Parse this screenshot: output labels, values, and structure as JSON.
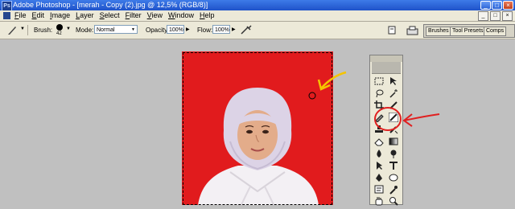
{
  "window": {
    "title": "Adobe Photoshop - [merah - Copy (2).jpg @ 12,5% (RGB/8)]",
    "icon": "photoshop-icon",
    "minimize": "_",
    "maximize": "□",
    "close": "×"
  },
  "menu": {
    "items": [
      "File",
      "Edit",
      "Image",
      "Layer",
      "Select",
      "Filter",
      "View",
      "Window",
      "Help"
    ]
  },
  "options": {
    "brush_label": "Brush:",
    "brush_size": "42",
    "mode_label": "Mode:",
    "mode_value": "Normal",
    "opacity_label": "Opacity:",
    "opacity_value": "100%",
    "flow_label": "Flow:",
    "flow_value": "100%",
    "dropdown_arrow": "▼",
    "flow_arrow": "▶"
  },
  "palette_well": {
    "tabs": [
      "Brushes",
      "Tool Presets",
      "Comps"
    ]
  },
  "colors": {
    "canvas_background": "#e11b1d",
    "annotation_yellow": "#f5c400",
    "annotation_red": "#e02020",
    "titlebar": "#1f52c9"
  },
  "toolbox": {
    "tools": [
      "marquee-icon",
      "move-icon",
      "lasso-icon",
      "magic-wand-icon",
      "crop-icon",
      "slice-icon",
      "healing-brush-icon",
      "brush-icon",
      "clone-stamp-icon",
      "history-brush-icon",
      "eraser-icon",
      "gradient-icon",
      "blur-icon",
      "dodge-icon",
      "path-selection-icon",
      "type-icon",
      "pen-icon",
      "shape-icon",
      "notes-icon",
      "eyedropper-icon",
      "hand-icon",
      "zoom-icon"
    ]
  }
}
